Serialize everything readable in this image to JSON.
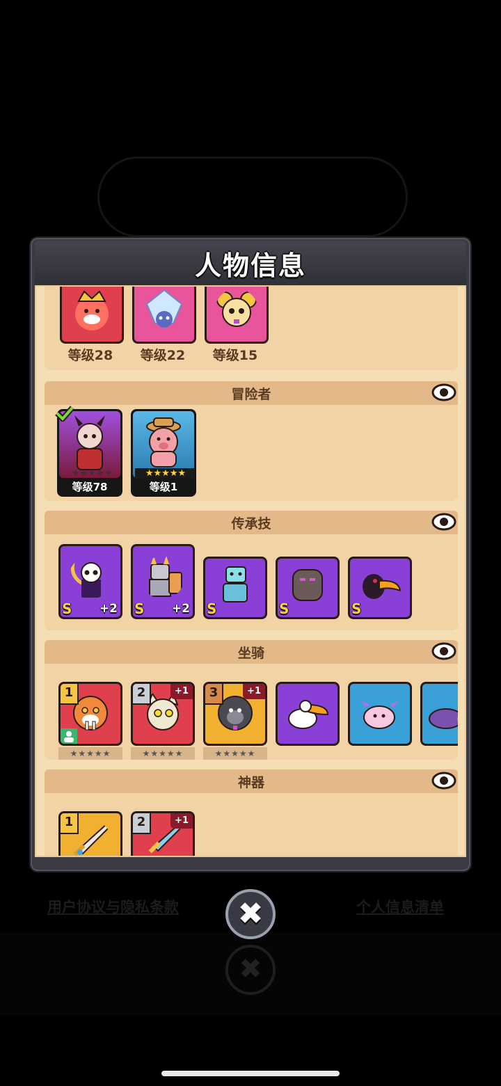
{
  "modal": {
    "title": "人物信息"
  },
  "pets_row": {
    "items": [
      {
        "level": "等级28",
        "icon": "red-king-creature-icon"
      },
      {
        "level": "等级22",
        "icon": "ice-crystal-creature-icon"
      },
      {
        "level": "等级15",
        "icon": "golden-mouse-creature-icon"
      }
    ]
  },
  "sections": {
    "adventurer": {
      "title": "冒险者",
      "cards": [
        {
          "level": "等级78",
          "icon": "horned-demon-hero-icon",
          "selected": true
        },
        {
          "level": "等级1",
          "icon": "pink-pig-hero-icon",
          "stars": "★★★★★"
        }
      ],
      "empty_stars": "★★★★★"
    },
    "legacy_skills": {
      "title": "传承技",
      "cards": [
        {
          "grade": "S",
          "plus": "+2",
          "icon": "skull-reaper-icon"
        },
        {
          "grade": "S",
          "plus": "+2",
          "icon": "armored-knight-icon"
        },
        {
          "grade": "S",
          "plus": "",
          "icon": "ice-golem-icon"
        },
        {
          "grade": "S",
          "plus": "",
          "icon": "stone-golem-icon"
        },
        {
          "grade": "S",
          "plus": "",
          "icon": "toucan-bird-icon"
        }
      ]
    },
    "mounts": {
      "title": "坐骑",
      "cards": [
        {
          "rank": "1",
          "plus": "",
          "icon": "sabertooth-tiger-icon",
          "stars": "★★★★★"
        },
        {
          "rank": "2",
          "plus": "+1",
          "icon": "mummy-cat-icon",
          "stars": "★★★★★"
        },
        {
          "rank": "3",
          "plus": "+1",
          "icon": "gorilla-icon",
          "stars": "★★★★★"
        },
        {
          "rank": "",
          "plus": "",
          "icon": "pelican-icon",
          "stars": ""
        },
        {
          "rank": "",
          "plus": "",
          "icon": "axolotl-icon",
          "stars": ""
        },
        {
          "rank": "",
          "plus": "",
          "icon": "turtle-icon",
          "stars": ""
        }
      ]
    },
    "artifacts": {
      "title": "神器",
      "cards": [
        {
          "rank": "1",
          "plus": "",
          "icon": "golden-sword-icon"
        },
        {
          "rank": "2",
          "plus": "+1",
          "icon": "red-dagger-icon"
        }
      ]
    }
  },
  "footer": {
    "agreement_link": "用户协议与隐私条款",
    "info_link": "个人信息清单",
    "close_glyph": "✖"
  },
  "colors": {
    "panel": "#f5ddb4",
    "section_head": "#e3b98a",
    "header": "#3b3b44",
    "purple_card": "#8a3fd6",
    "red_card": "#e0404e",
    "blue_card": "#3aa0d8",
    "pink_card": "#e8559a",
    "gold_card": "#f0b030"
  }
}
